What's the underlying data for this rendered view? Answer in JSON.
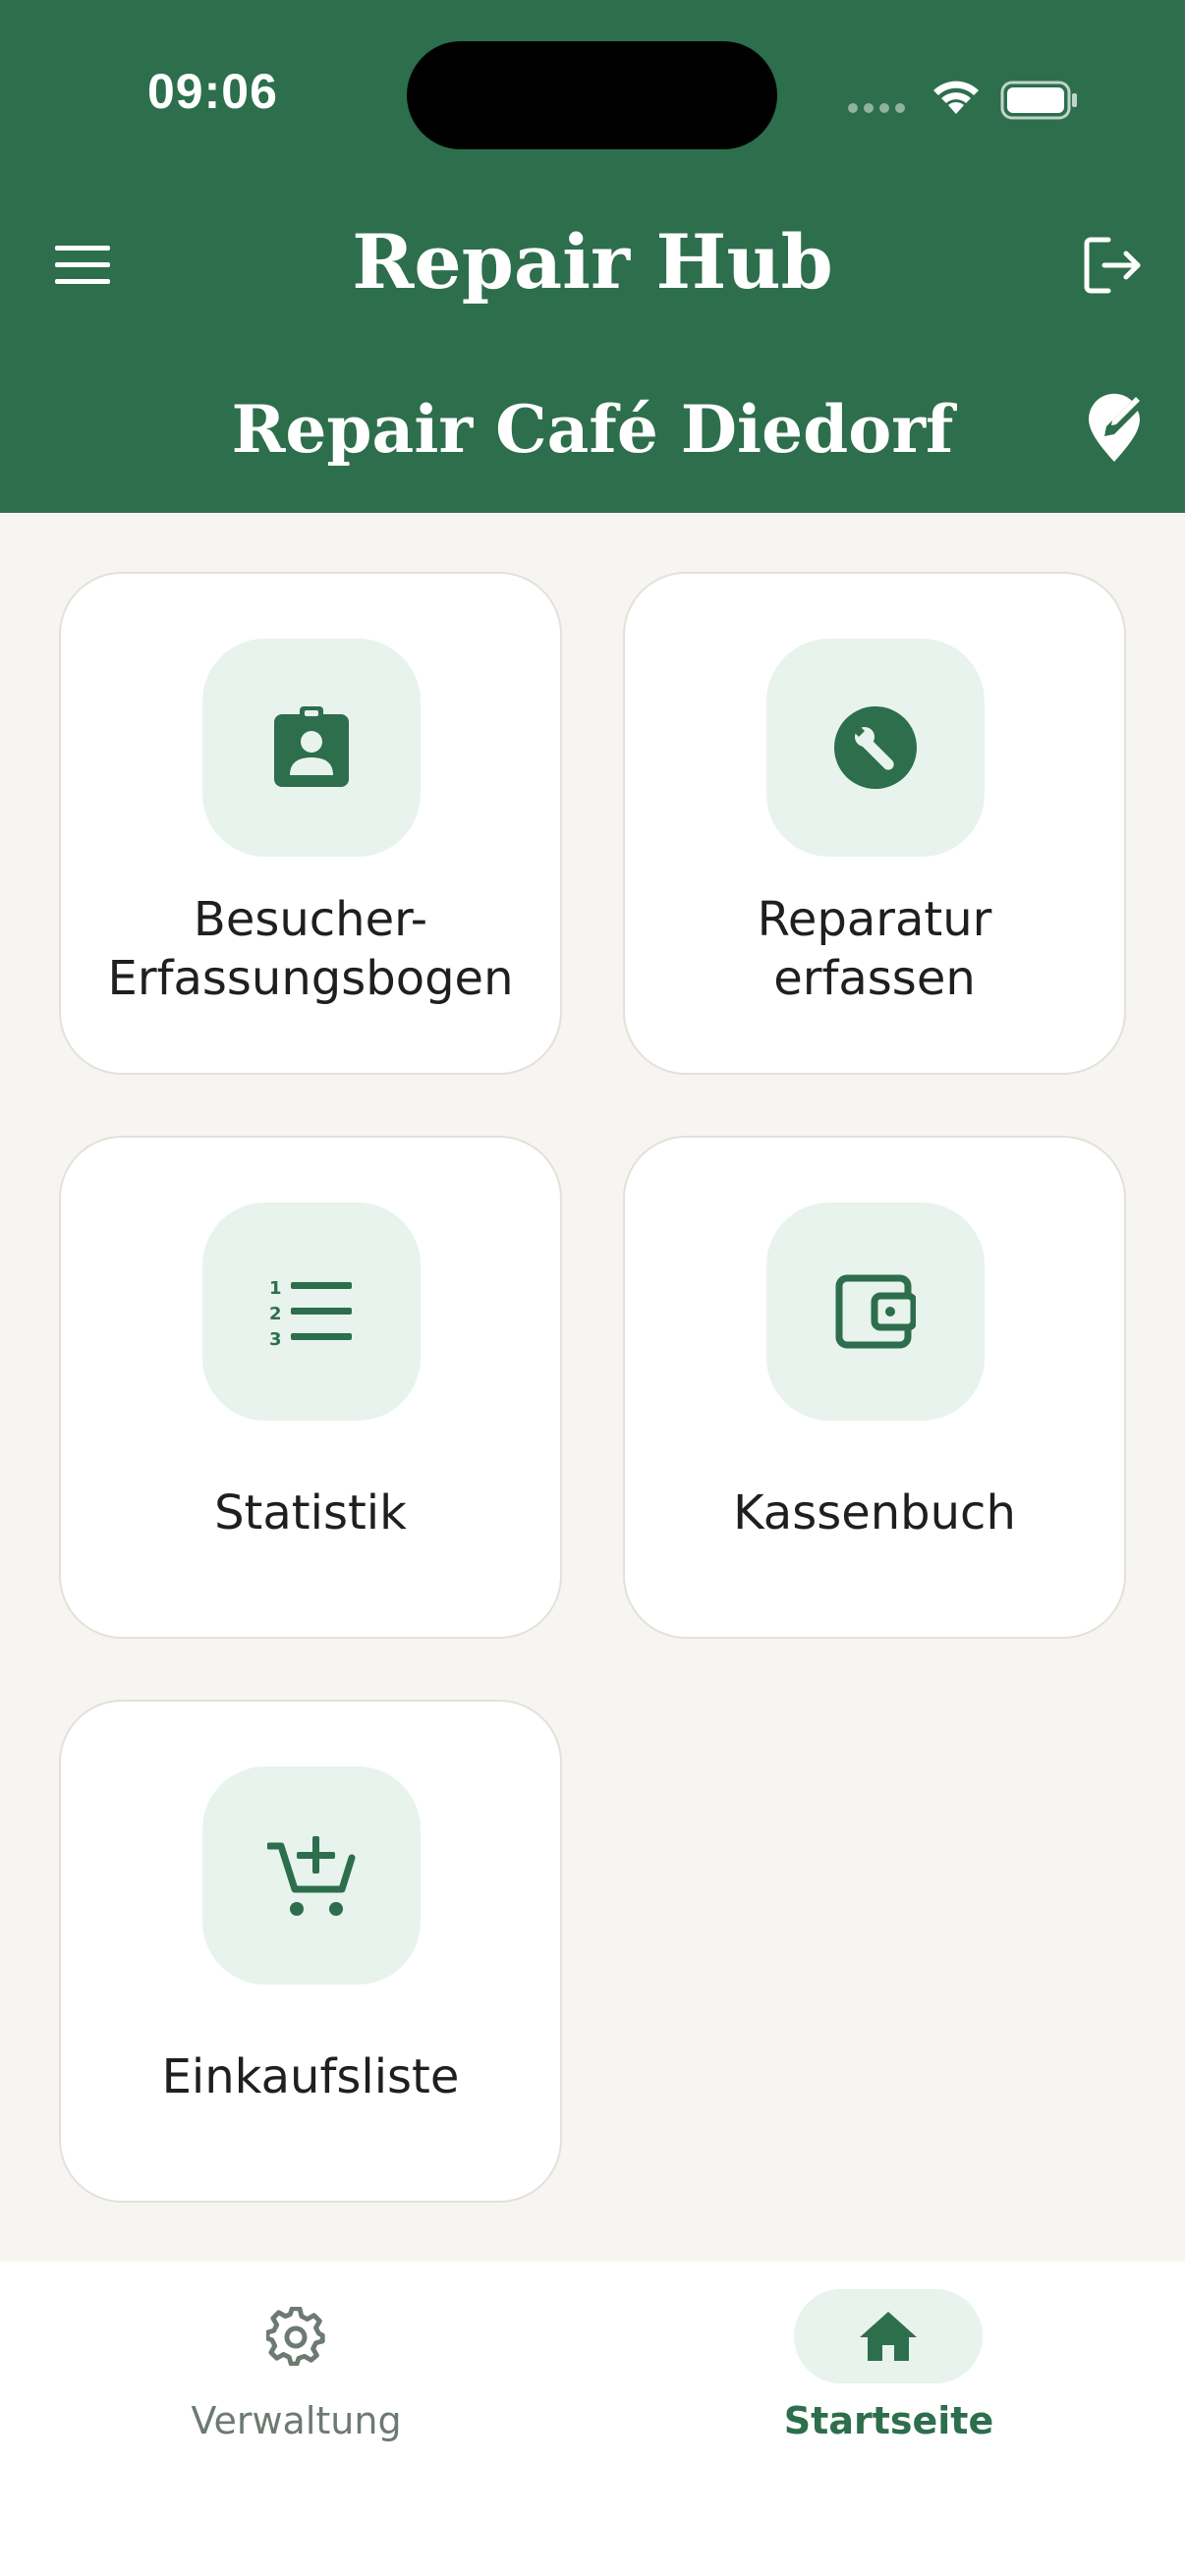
{
  "status_bar": {
    "time": "09:06",
    "icons": [
      "cellular-dots-icon",
      "wifi-icon",
      "battery-icon"
    ]
  },
  "header": {
    "title": "Repair Hub",
    "cafe_name": "Repair Café Diedorf",
    "menu_icon": "menu-icon",
    "logout_icon": "logout-icon",
    "location_icon": "location-edit-icon"
  },
  "tiles": [
    {
      "label_line1": "Besucher-",
      "label_line2": "Erfassungsbogen",
      "icon": "visitor-badge-icon"
    },
    {
      "label_line1": "Reparatur",
      "label_line2": "erfassen",
      "icon": "wrench-icon"
    },
    {
      "label": "Statistik",
      "icon": "numbered-list-icon"
    },
    {
      "label": "Kassenbuch",
      "icon": "wallet-icon"
    },
    {
      "label": "Einkaufsliste",
      "icon": "cart-add-icon"
    }
  ],
  "bottom_nav": {
    "items": [
      {
        "label": "Verwaltung",
        "icon": "gear-icon",
        "active": false
      },
      {
        "label": "Startseite",
        "icon": "home-icon",
        "active": true
      }
    ]
  },
  "colors": {
    "brand_green": "#2d6e4c",
    "tile_icon_bg": "#e7f3ec",
    "page_bg": "#f6f5f1",
    "inactive_nav": "#6c7a72"
  }
}
